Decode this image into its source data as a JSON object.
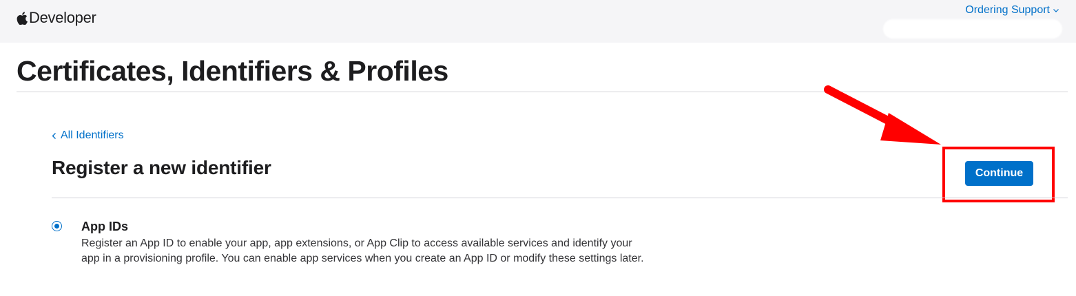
{
  "header": {
    "brand": "Developer",
    "ordering_support": "Ordering Support"
  },
  "page": {
    "title": "Certificates, Identifiers & Profiles"
  },
  "main": {
    "back_link": "All Identifiers",
    "section_title": "Register a new identifier",
    "continue_label": "Continue"
  },
  "options": [
    {
      "title": "App IDs",
      "description": "Register an App ID to enable your app, app extensions, or App Clip to access available services and identify your app in a provisioning profile. You can enable app services when you create an App ID or modify these settings later.",
      "selected": true
    }
  ],
  "icons": {
    "logo": "apple-logo-icon",
    "dropdown": "chevron-down-icon",
    "back": "chevron-left-icon"
  },
  "colors": {
    "accent": "#0070c9",
    "header_bg": "#f5f5f7",
    "annotation": "#ff0000"
  }
}
